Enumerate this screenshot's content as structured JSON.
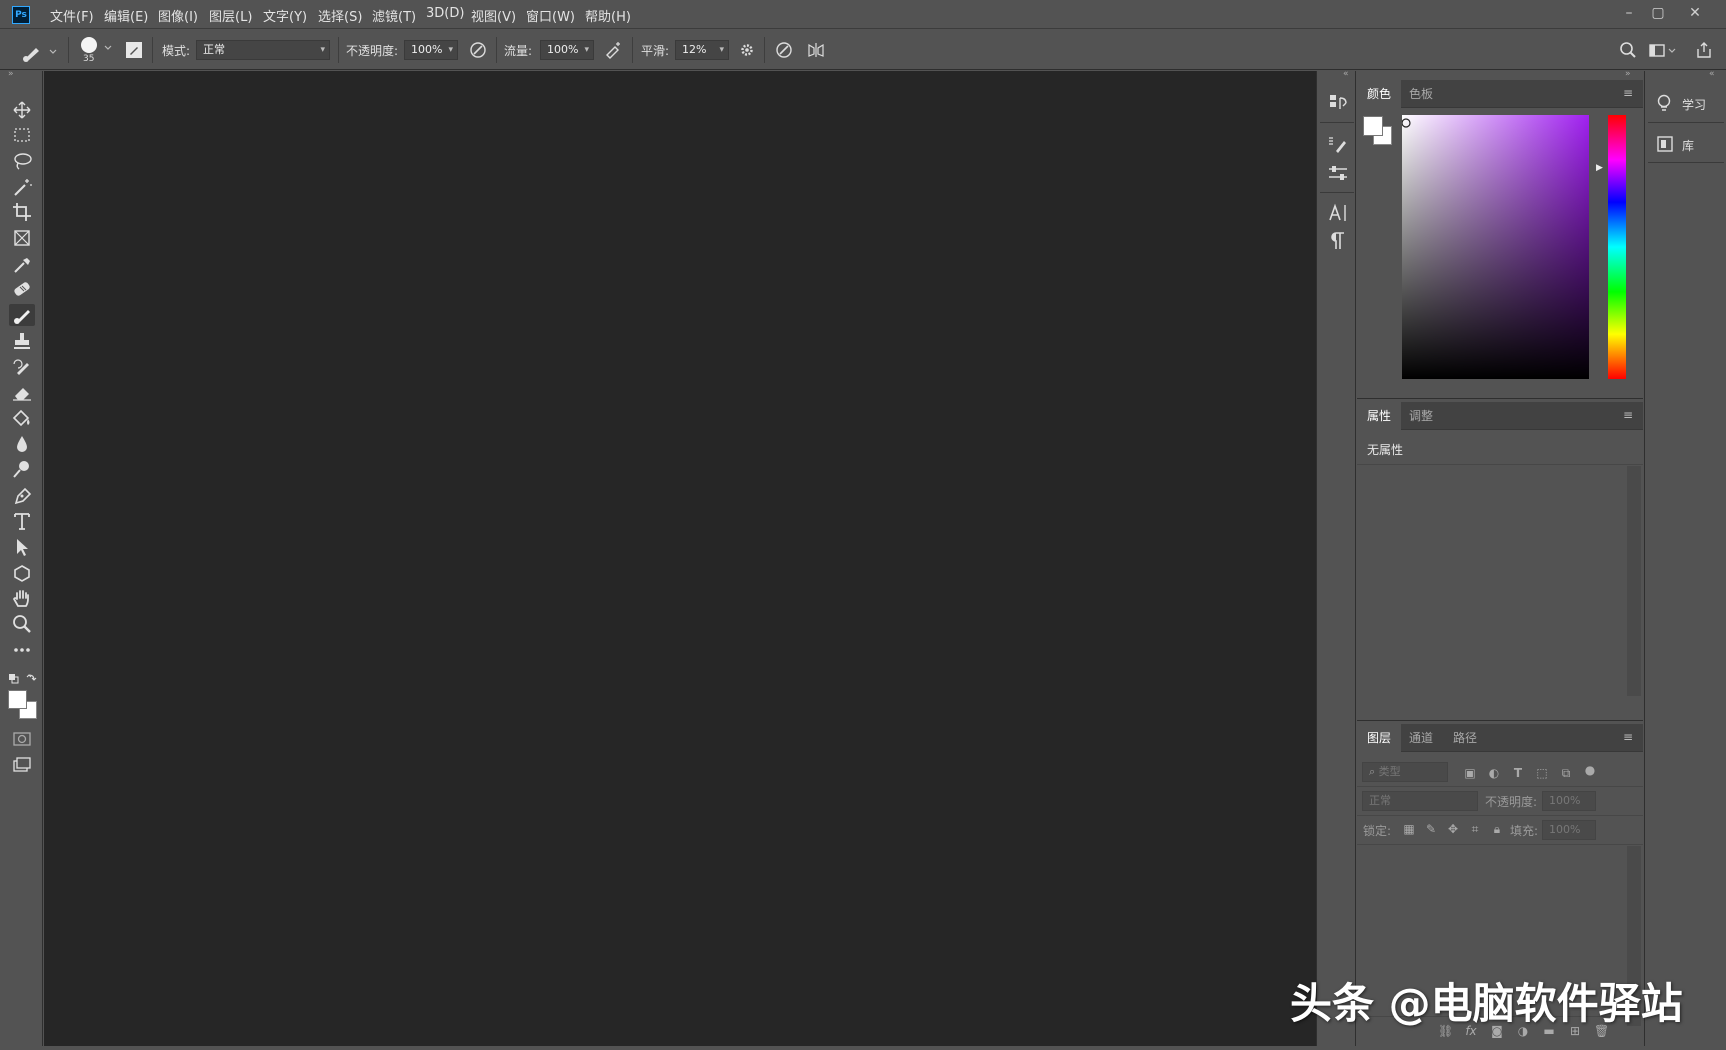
{
  "app": {
    "logo_text": "Ps"
  },
  "menu": [
    "文件(F)",
    "编辑(E)",
    "图像(I)",
    "图层(L)",
    "文字(Y)",
    "选择(S)",
    "滤镜(T)",
    "3D(D)",
    "视图(V)",
    "窗口(W)",
    "帮助(H)"
  ],
  "window_controls": {
    "minimize": "–",
    "maximize": "▢",
    "close": "✕"
  },
  "options": {
    "brush_size": "35",
    "mode_label": "模式:",
    "mode_value": "正常",
    "opacity_label": "不透明度:",
    "opacity_value": "100%",
    "flow_label": "流量:",
    "flow_value": "100%",
    "smoothing_label": "平滑:",
    "smoothing_value": "12%"
  },
  "tools": [
    "move-tool",
    "marquee-tool",
    "lasso-tool",
    "magic-wand-tool",
    "crop-tool",
    "frame-tool",
    "eyedropper-tool",
    "healing-brush-tool",
    "brush-tool",
    "clone-stamp-tool",
    "history-brush-tool",
    "eraser-tool",
    "paint-bucket-tool",
    "blur-tool",
    "dodge-tool",
    "pen-tool",
    "type-tool",
    "path-selection-tool",
    "shape-tool",
    "hand-tool",
    "zoom-tool",
    "more-tools"
  ],
  "active_tool": "brush-tool",
  "colors": {
    "foreground": "#ffffff",
    "background": "#ffffff",
    "accent": "#31a8ff",
    "canvas_bg": "#262626"
  },
  "color_panel": {
    "tabs": [
      "颜色",
      "色板"
    ],
    "active_tab": "颜色",
    "hue_color": "#a020f0"
  },
  "properties_panel": {
    "tabs": [
      "属性",
      "调整"
    ],
    "active_tab": "属性",
    "empty_text": "无属性"
  },
  "layers_panel": {
    "tabs": [
      "图层",
      "通道",
      "路径"
    ],
    "active_tab": "图层",
    "filter_placeholder": "类型",
    "blend_mode": "正常",
    "opacity_label": "不透明度:",
    "opacity_value": "100%",
    "lock_label": "锁定:",
    "fill_label": "填充:",
    "fill_value": "100%"
  },
  "right_dock": {
    "items": [
      {
        "label": "学习",
        "icon": "lightbulb-icon"
      },
      {
        "label": "库",
        "icon": "library-icon"
      }
    ]
  },
  "watermark": "头条 @电脑软件驿站"
}
